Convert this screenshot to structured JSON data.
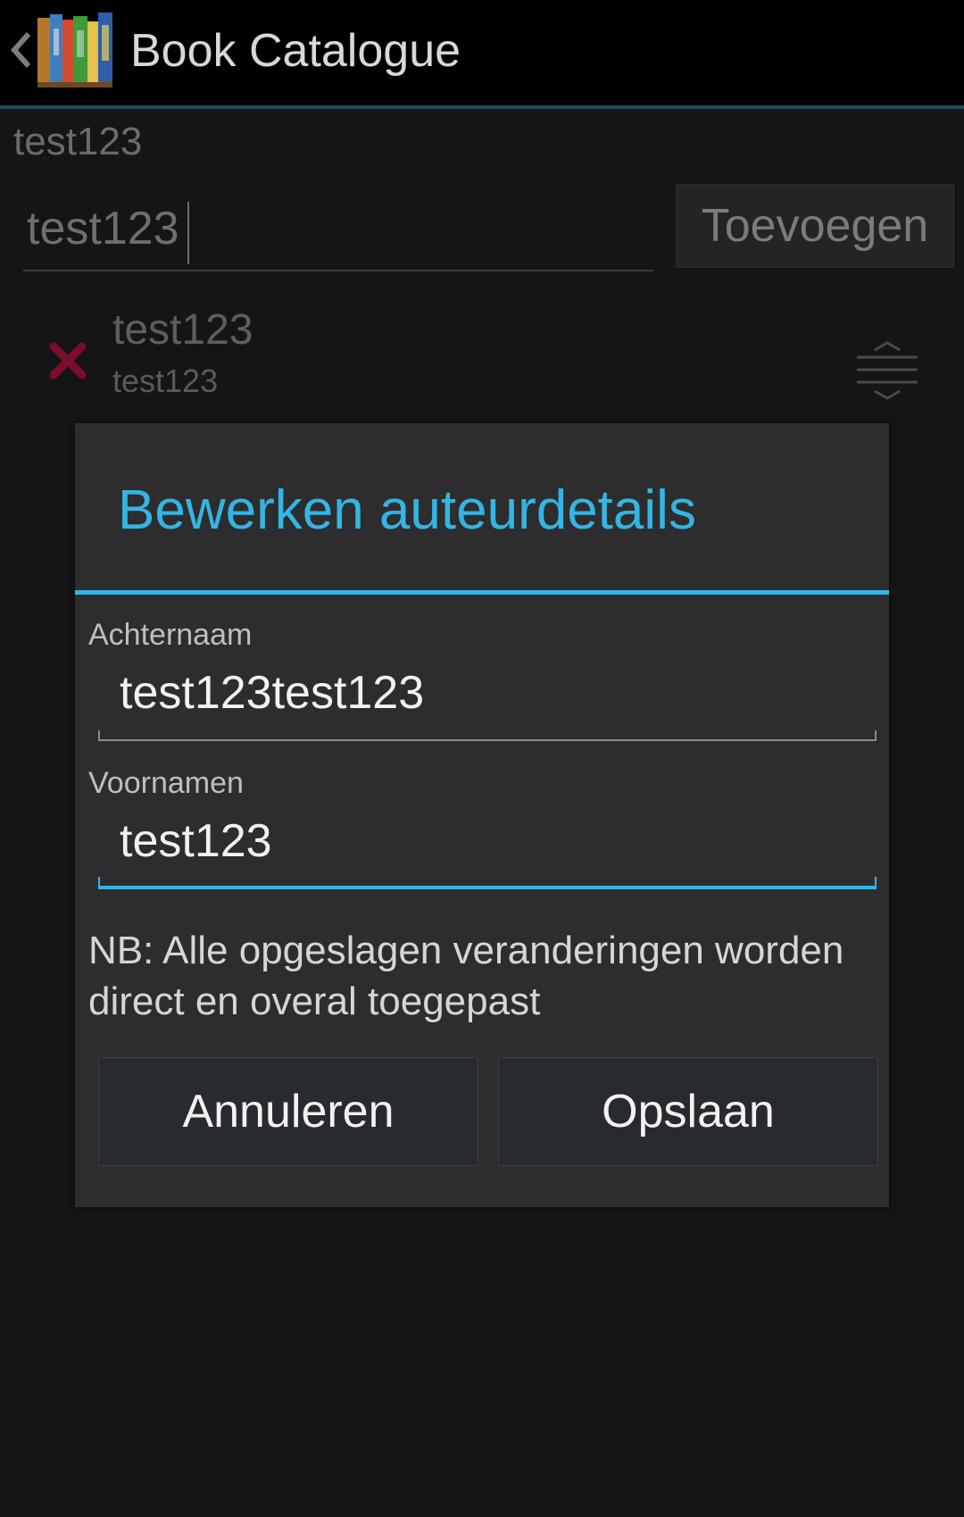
{
  "action_bar": {
    "title": "Book Catalogue",
    "up_icon": "chevron-left-icon",
    "app_icon": "book-catalogue-app-icon"
  },
  "background": {
    "heading": "test123",
    "input_value": "test123",
    "add_button_label": "Toevoegen",
    "row": {
      "title": "test123",
      "subtitle": "test123",
      "delete_icon": "delete-x-icon",
      "delete_icon_color": "#8b0f2e",
      "drag_icon": "drag-handle-icon"
    }
  },
  "dialog": {
    "title": "Bewerken auteurdetails",
    "accent_color": "#33b5e5",
    "family_name": {
      "label": "Achternaam",
      "value": "test123test123"
    },
    "given_names": {
      "label": "Voornamen",
      "value": "test123"
    },
    "note": "NB: Alle opgeslagen veranderingen worden direct en overal toegepast",
    "cancel_label": "Annuleren",
    "save_label": "Opslaan"
  }
}
